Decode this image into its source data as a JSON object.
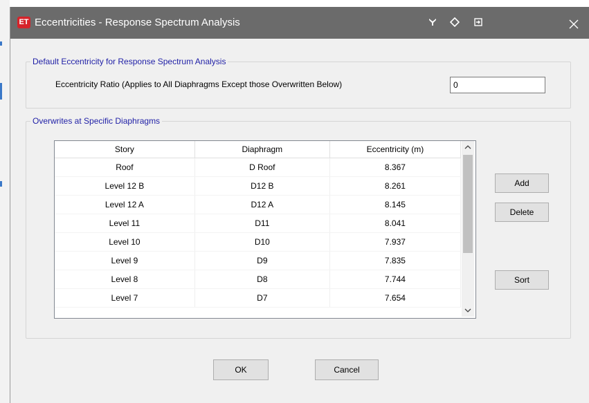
{
  "window": {
    "app_icon_text": "ET",
    "title": "Eccentricities - Response Spectrum Analysis",
    "title_buttons": [
      "pin-icon",
      "move-icon",
      "restore-icon",
      "close-icon"
    ]
  },
  "default_group": {
    "title": "Default Eccentricity for Response Spectrum Analysis",
    "ratio_label": "Eccentricity Ratio (Applies to All Diaphragms Except those Overwritten Below)",
    "ratio_value": "0"
  },
  "overwrites_group": {
    "title": "Overwrites at Specific Diaphragms",
    "columns": [
      "Story",
      "Diaphragm",
      "Eccentricity (m)"
    ],
    "rows": [
      [
        "Roof",
        "D Roof",
        "8.367"
      ],
      [
        "Level 12 B",
        "D12 B",
        "8.261"
      ],
      [
        "Level 12 A",
        "D12 A",
        "8.145"
      ],
      [
        "Level 11",
        "D11",
        "8.041"
      ],
      [
        "Level 10",
        "D10",
        "7.937"
      ],
      [
        "Level 9",
        "D9",
        "7.835"
      ],
      [
        "Level 8",
        "D8",
        "7.744"
      ],
      [
        "Level 7",
        "D7",
        "7.654"
      ]
    ],
    "add_label": "Add",
    "delete_label": "Delete",
    "sort_label": "Sort"
  },
  "footer": {
    "ok_label": "OK",
    "cancel_label": "Cancel"
  },
  "colors": {
    "titlebar": "#6b6b6b",
    "group_title": "#1e1ea6",
    "icon_red": "#d6232a"
  }
}
